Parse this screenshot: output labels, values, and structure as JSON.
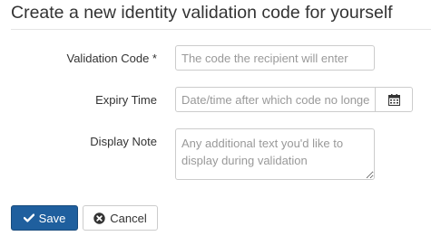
{
  "form": {
    "title": "Create a new identity validation code for yourself",
    "fields": {
      "validation_code": {
        "label": "Validation Code *",
        "placeholder": "The code the recipient will enter",
        "value": ""
      },
      "expiry_time": {
        "label": "Expiry Time",
        "placeholder": "Date/time after which code no longer valid",
        "value": "",
        "button_icon": "calendar-icon"
      },
      "display_note": {
        "label": "Display Note",
        "placeholder": "Any additional text you'd like to display during validation",
        "value": ""
      }
    },
    "actions": {
      "save_label": "Save",
      "save_icon": "check-icon",
      "cancel_label": "Cancel",
      "cancel_icon": "times-circle-icon"
    }
  },
  "colors": {
    "primary": "#1f5f9e",
    "text": "#333333",
    "placeholder": "#999999",
    "border": "#cccccc"
  }
}
